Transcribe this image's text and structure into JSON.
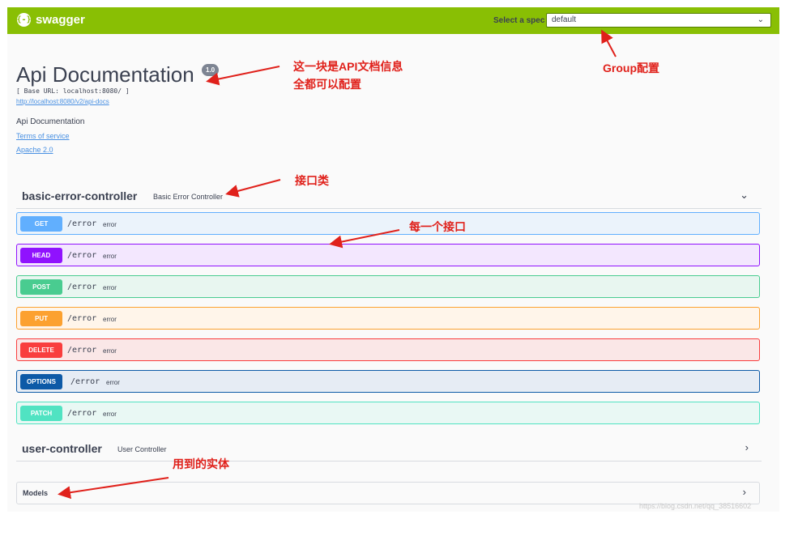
{
  "header": {
    "logo_icon": "{-}",
    "logo_text": "swagger",
    "select_label": "Select a spec",
    "select_value": "default"
  },
  "info": {
    "title": "Api Documentation",
    "version": "1.0",
    "base_url": "[ Base URL: localhost:8080/ ]",
    "api_docs_link": "http://localhost:8080/v2/api-docs",
    "description": "Api Documentation",
    "terms": "Terms of service",
    "license": "Apache 2.0"
  },
  "tags": [
    {
      "name": "basic-error-controller",
      "description": "Basic Error Controller",
      "expanded": true,
      "operations": [
        {
          "method": "GET",
          "path": "/error",
          "summary": "error",
          "color": "#61affe",
          "bg": "#ebf3fb"
        },
        {
          "method": "HEAD",
          "path": "/error",
          "summary": "error",
          "color": "#9012fe",
          "bg": "#f3e7fe"
        },
        {
          "method": "POST",
          "path": "/error",
          "summary": "error",
          "color": "#49cc90",
          "bg": "#e8f6f0"
        },
        {
          "method": "PUT",
          "path": "/error",
          "summary": "error",
          "color": "#fca130",
          "bg": "#fff5ea"
        },
        {
          "method": "DELETE",
          "path": "/error",
          "summary": "error",
          "color": "#f93e3e",
          "bg": "#fae7e7"
        },
        {
          "method": "OPTIONS",
          "path": "/error",
          "summary": "error",
          "color": "#0d5aa7",
          "bg": "#e6ecf4"
        },
        {
          "method": "PATCH",
          "path": "/error",
          "summary": "error",
          "color": "#50e3c2",
          "bg": "#e9f8f4"
        }
      ]
    },
    {
      "name": "user-controller",
      "description": "User Controller",
      "expanded": false,
      "operations": []
    }
  ],
  "models": {
    "label": "Models"
  },
  "annotations": {
    "info_line1": "这一块是API文档信息",
    "info_line2": "全都可以配置",
    "group": "Group配置",
    "controller": "接口类",
    "endpoint": "每一个接口",
    "entity": "用到的实体"
  },
  "watermark": "https://blog.csdn.net/qq_38516602",
  "icons": {
    "chevron_down": "chevron-down-icon",
    "chevron_right": "chevron-right-icon"
  },
  "colors": {
    "topbar": "#89bf04",
    "annotation": "#e0211b",
    "link": "#4990e2"
  }
}
